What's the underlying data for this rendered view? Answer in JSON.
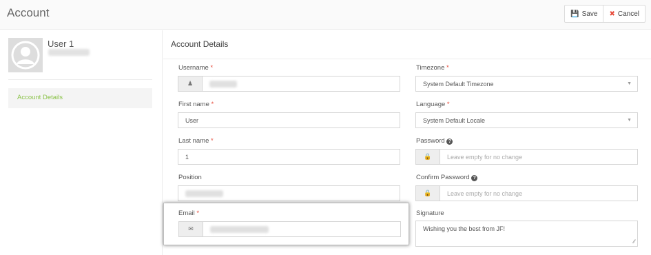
{
  "header": {
    "title": "Account",
    "save_label": "Save",
    "cancel_label": "Cancel"
  },
  "sidebar": {
    "user_name": "User 1",
    "items": [
      {
        "label": "Account Details"
      }
    ]
  },
  "main": {
    "section_title": "Account Details",
    "fields": {
      "username": {
        "label": "Username",
        "required": "*"
      },
      "first_name": {
        "label": "First name",
        "required": "*",
        "value": "User"
      },
      "last_name": {
        "label": "Last name",
        "required": "*",
        "value": "1"
      },
      "position": {
        "label": "Position"
      },
      "email": {
        "label": "Email",
        "required": "*"
      },
      "timezone": {
        "label": "Timezone",
        "required": "*",
        "value": "System Default Timezone"
      },
      "language": {
        "label": "Language",
        "required": "*",
        "value": "System Default Locale"
      },
      "password": {
        "label": "Password",
        "placeholder": "Leave empty for no change"
      },
      "confirm_password": {
        "label": "Confirm Password",
        "placeholder": "Leave empty for no change"
      },
      "signature": {
        "label": "Signature",
        "value": "Wishing you the best from JF!"
      }
    }
  },
  "colors": {
    "accent_green": "#8bc34a",
    "required_red": "#e74c3c",
    "save_blue": "#3c8dbc"
  },
  "icons": {
    "save": "floppy-disk-icon",
    "cancel": "x-icon",
    "username": "user-icon",
    "email": "envelope-icon",
    "password": "lock-icon",
    "help": "question-circle-icon"
  }
}
